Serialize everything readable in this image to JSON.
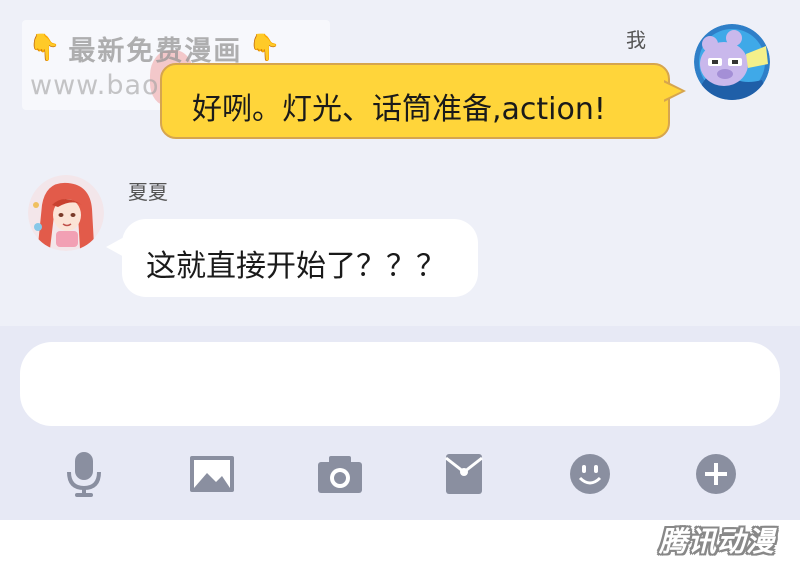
{
  "watermark": {
    "line1": "最新免费漫画",
    "hand_icon": "👇",
    "line2": "www.baozimh.com"
  },
  "messages": [
    {
      "sender": "我",
      "text": "好咧。灯光、话筒准备,action!",
      "bubble_color": "#ffd53a"
    },
    {
      "sender": "夏夏",
      "text": "这就直接开始了？？？",
      "bubble_color": "#ffffff"
    }
  ],
  "composer": {
    "input_value": "",
    "icons": [
      "microphone-icon",
      "image-icon",
      "camera-icon",
      "red-packet-icon",
      "emoji-icon",
      "plus-icon"
    ],
    "icon_color": "#8a8fa0"
  },
  "brand_logo": "腾讯动漫",
  "colors": {
    "chat_bg": "#eef0f8",
    "composer_bg": "#e7e9f5"
  }
}
